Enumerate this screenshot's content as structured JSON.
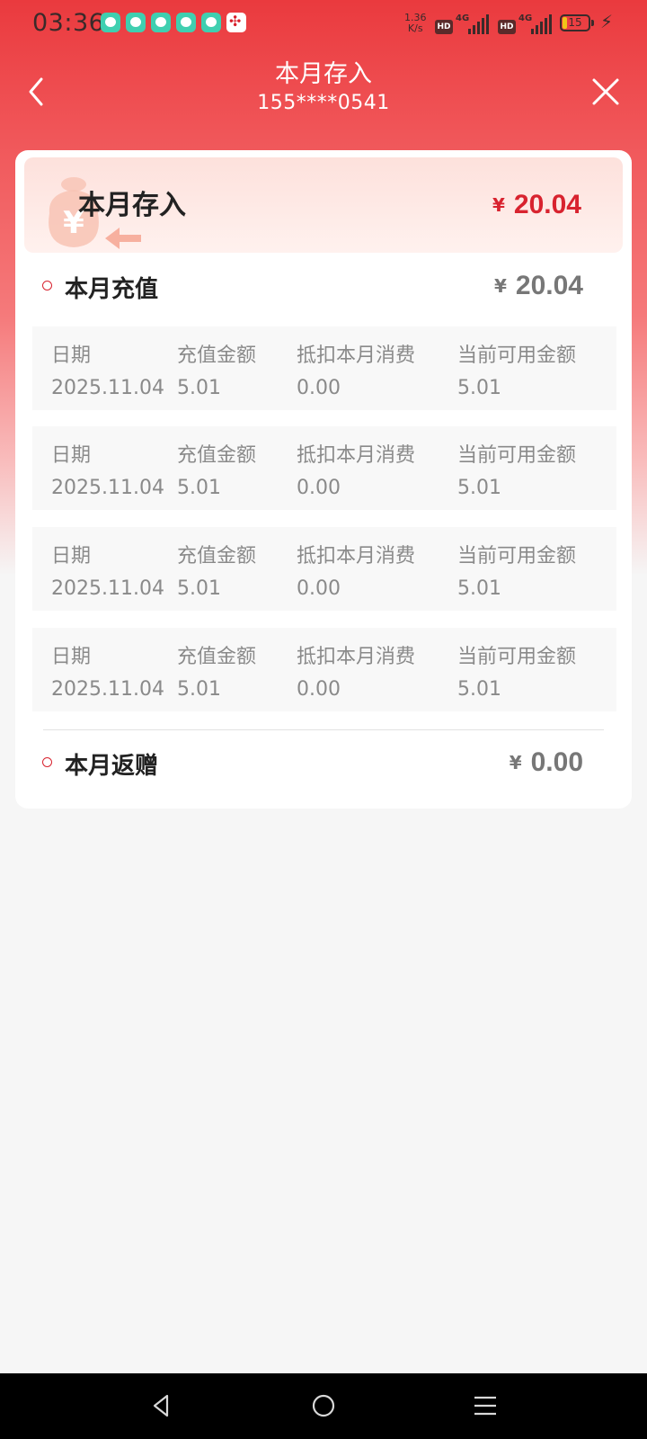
{
  "status_bar": {
    "time": "03:36",
    "net_speed_value": "1.36",
    "net_speed_unit": "K/s",
    "hd1": "HD",
    "sig1": "4G",
    "hd2": "HD",
    "sig2": "4G",
    "battery_level": "15",
    "notification_icons": [
      "chat-app-icon",
      "chat-app-icon",
      "chat-app-icon",
      "chat-app-icon",
      "chat-app-icon",
      "china-unicom-icon"
    ]
  },
  "header": {
    "title": "本月存入",
    "subtitle": "155****0541"
  },
  "summary": {
    "label": "本月存入",
    "currency": "¥",
    "amount": "20.04"
  },
  "recharge": {
    "label": "本月充值",
    "currency": "¥",
    "amount": "20.04",
    "columns": [
      "日期",
      "充值金额",
      "抵扣本月消费",
      "当前可用金额"
    ],
    "records": [
      [
        "2025.11.04",
        "5.01",
        "0.00",
        "5.01"
      ],
      [
        "2025.11.04",
        "5.01",
        "0.00",
        "5.01"
      ],
      [
        "2025.11.04",
        "5.01",
        "0.00",
        "5.01"
      ],
      [
        "2025.11.04",
        "5.01",
        "0.00",
        "5.01"
      ]
    ]
  },
  "bonus": {
    "label": "本月返赠",
    "currency": "¥",
    "amount": "0.00"
  },
  "colors": {
    "brand_red": "#e8383d",
    "amount_red": "#d8232f"
  }
}
